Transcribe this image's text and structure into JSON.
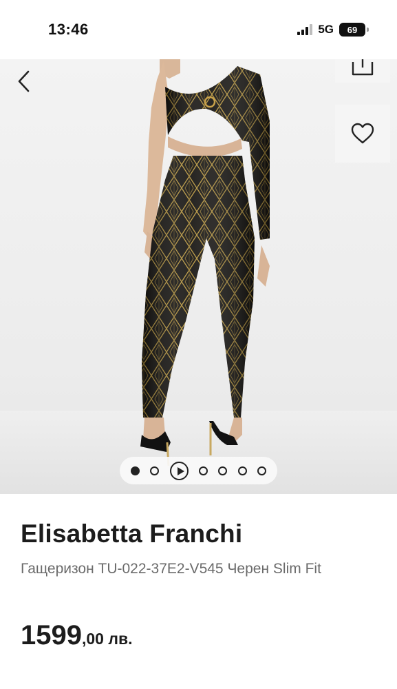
{
  "status_bar": {
    "time": "13:46",
    "network": "5G",
    "battery": "69"
  },
  "gallery": {
    "icons": [
      "back-chevron",
      "share",
      "heart"
    ],
    "indicator_count": 7,
    "active_index": 0,
    "video_index": 2
  },
  "product": {
    "brand": "Elisabetta Franchi",
    "description": "Гащеризон TU-022-37E2-V545 Черен Slim Fit",
    "price_int": "1599",
    "price_dec": ",00 лв."
  }
}
